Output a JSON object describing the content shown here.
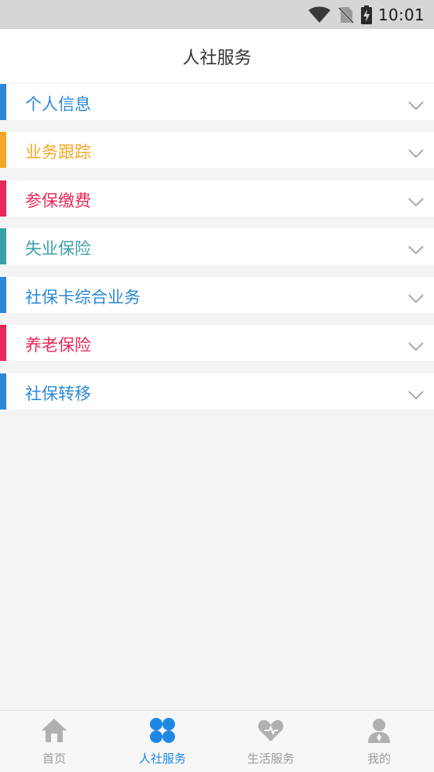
{
  "status_bar": {
    "time": "10:01",
    "icons": [
      "wifi-icon",
      "no-sim-icon",
      "battery-charging-icon"
    ]
  },
  "header": {
    "title": "人社服务"
  },
  "menu": {
    "items": [
      {
        "label": "个人信息",
        "color": "#2b88d8",
        "icon": "chevron-down-icon"
      },
      {
        "label": "业务跟踪",
        "color": "#f4a828",
        "icon": "chevron-down-icon"
      },
      {
        "label": "参保缴费",
        "color": "#e8285a",
        "icon": "chevron-down-icon"
      },
      {
        "label": "失业保险",
        "color": "#3aa0a8",
        "icon": "chevron-down-icon"
      },
      {
        "label": "社保卡综合业务",
        "color": "#2b88d8",
        "icon": "chevron-down-icon"
      },
      {
        "label": "养老保险",
        "color": "#e8285a",
        "icon": "chevron-down-icon"
      },
      {
        "label": "社保转移",
        "color": "#2b88d8",
        "icon": "chevron-down-icon"
      }
    ]
  },
  "tab_bar": {
    "active_color": "#1e88e5",
    "inactive_color": "#9a9a9a",
    "tabs": [
      {
        "label": "首页",
        "icon": "home-icon",
        "active": false
      },
      {
        "label": "人社服务",
        "icon": "clover-icon",
        "active": true
      },
      {
        "label": "生活服务",
        "icon": "heart-icon",
        "active": false
      },
      {
        "label": "我的",
        "icon": "person-icon",
        "active": false
      }
    ]
  }
}
